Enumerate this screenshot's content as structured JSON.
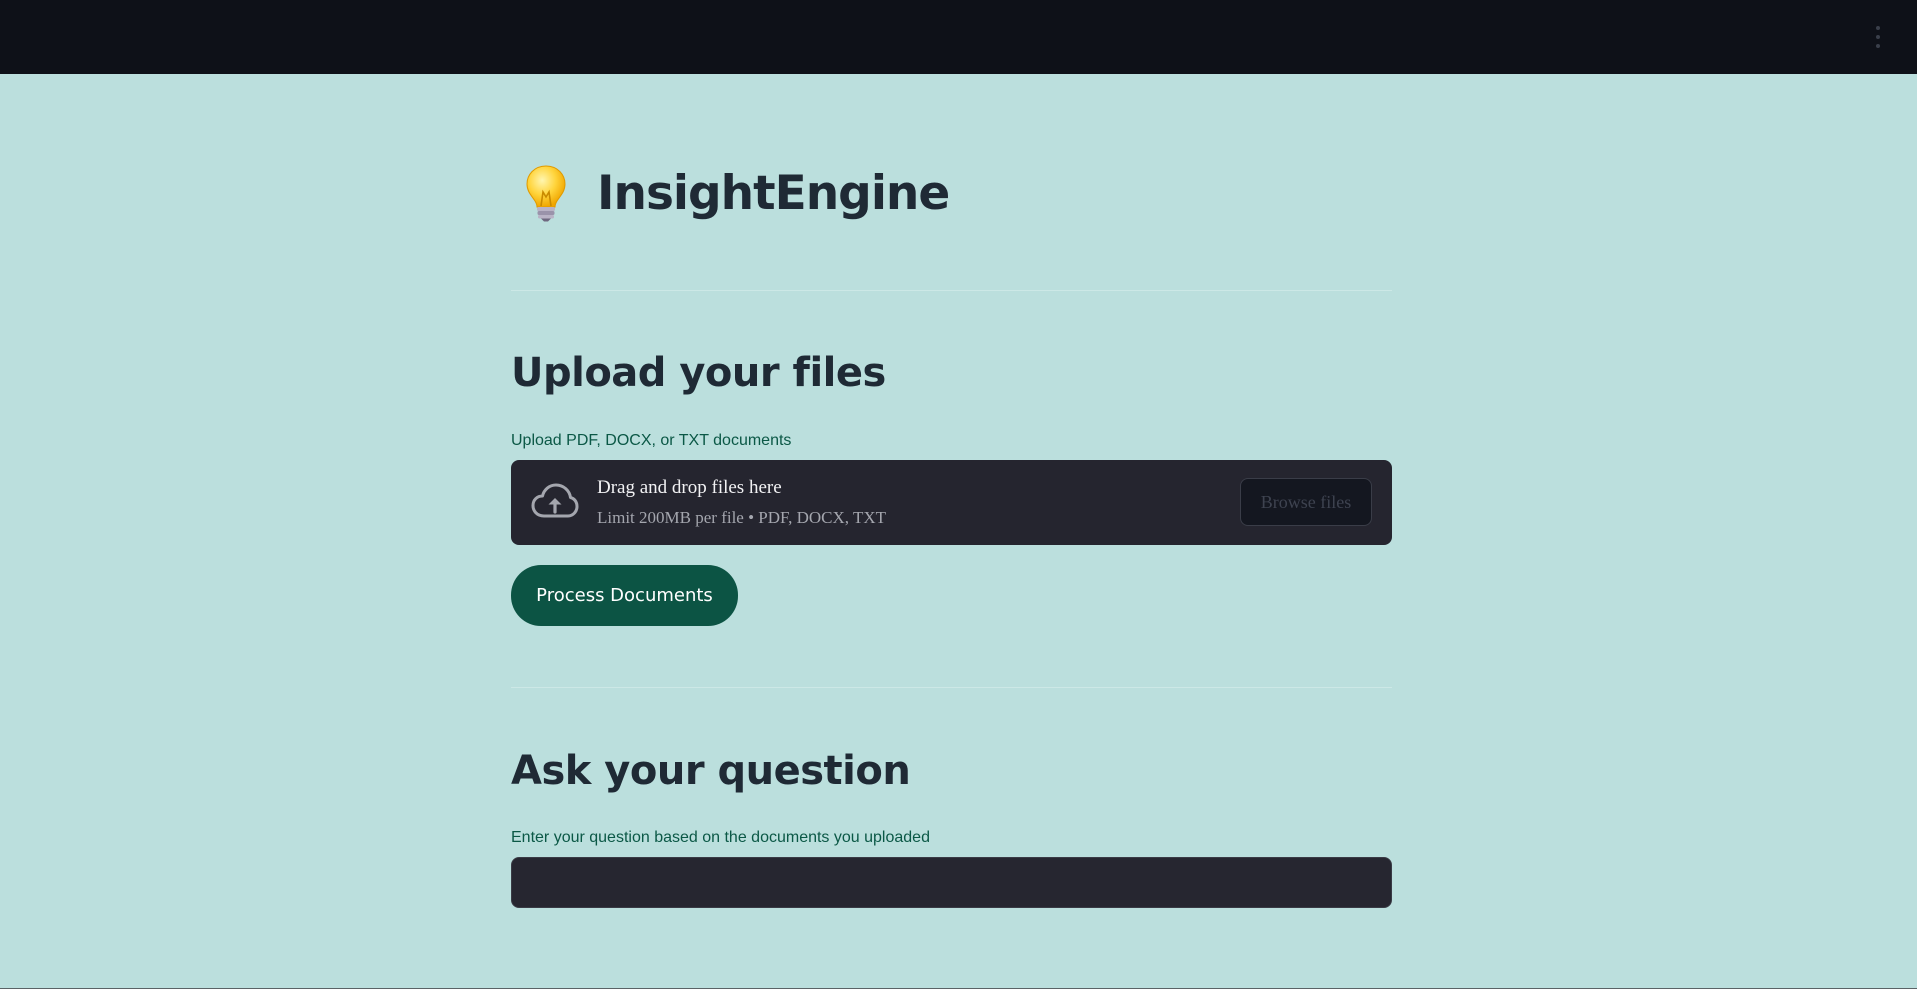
{
  "app": {
    "title": "InsightEngine",
    "icon": "lightbulb-icon"
  },
  "topbar": {
    "menu_icon": "vertical-dots-icon"
  },
  "upload": {
    "heading": "Upload your files",
    "label": "Upload PDF, DOCX, or TXT documents",
    "dropzone_title": "Drag and drop files here",
    "dropzone_subtitle": "Limit 200MB per file • PDF, DOCX, TXT",
    "browse_label": "Browse files",
    "process_label": "Process Documents"
  },
  "question": {
    "heading": "Ask your question",
    "label": "Enter your question based on the documents you uploaded",
    "value": ""
  },
  "colors": {
    "background": "#bbdfdd",
    "topbar": "#0e1118",
    "accent": "#0c5444",
    "label_text": "#0b5846",
    "heading_text": "#1f2a35",
    "dropzone_bg": "#25252f"
  }
}
